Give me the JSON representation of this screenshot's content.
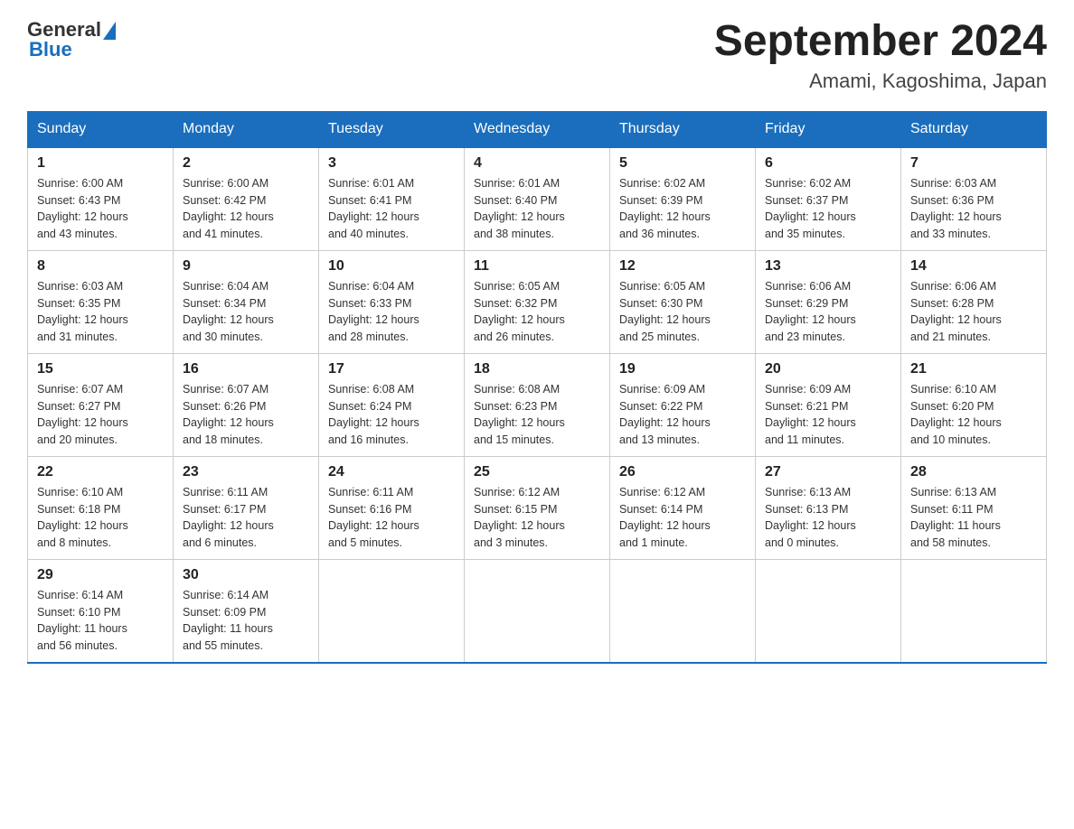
{
  "logo": {
    "general": "General",
    "blue": "Blue"
  },
  "title": "September 2024",
  "location": "Amami, Kagoshima, Japan",
  "days_of_week": [
    "Sunday",
    "Monday",
    "Tuesday",
    "Wednesday",
    "Thursday",
    "Friday",
    "Saturday"
  ],
  "weeks": [
    [
      {
        "day": "1",
        "info": "Sunrise: 6:00 AM\nSunset: 6:43 PM\nDaylight: 12 hours\nand 43 minutes."
      },
      {
        "day": "2",
        "info": "Sunrise: 6:00 AM\nSunset: 6:42 PM\nDaylight: 12 hours\nand 41 minutes."
      },
      {
        "day": "3",
        "info": "Sunrise: 6:01 AM\nSunset: 6:41 PM\nDaylight: 12 hours\nand 40 minutes."
      },
      {
        "day": "4",
        "info": "Sunrise: 6:01 AM\nSunset: 6:40 PM\nDaylight: 12 hours\nand 38 minutes."
      },
      {
        "day": "5",
        "info": "Sunrise: 6:02 AM\nSunset: 6:39 PM\nDaylight: 12 hours\nand 36 minutes."
      },
      {
        "day": "6",
        "info": "Sunrise: 6:02 AM\nSunset: 6:37 PM\nDaylight: 12 hours\nand 35 minutes."
      },
      {
        "day": "7",
        "info": "Sunrise: 6:03 AM\nSunset: 6:36 PM\nDaylight: 12 hours\nand 33 minutes."
      }
    ],
    [
      {
        "day": "8",
        "info": "Sunrise: 6:03 AM\nSunset: 6:35 PM\nDaylight: 12 hours\nand 31 minutes."
      },
      {
        "day": "9",
        "info": "Sunrise: 6:04 AM\nSunset: 6:34 PM\nDaylight: 12 hours\nand 30 minutes."
      },
      {
        "day": "10",
        "info": "Sunrise: 6:04 AM\nSunset: 6:33 PM\nDaylight: 12 hours\nand 28 minutes."
      },
      {
        "day": "11",
        "info": "Sunrise: 6:05 AM\nSunset: 6:32 PM\nDaylight: 12 hours\nand 26 minutes."
      },
      {
        "day": "12",
        "info": "Sunrise: 6:05 AM\nSunset: 6:30 PM\nDaylight: 12 hours\nand 25 minutes."
      },
      {
        "day": "13",
        "info": "Sunrise: 6:06 AM\nSunset: 6:29 PM\nDaylight: 12 hours\nand 23 minutes."
      },
      {
        "day": "14",
        "info": "Sunrise: 6:06 AM\nSunset: 6:28 PM\nDaylight: 12 hours\nand 21 minutes."
      }
    ],
    [
      {
        "day": "15",
        "info": "Sunrise: 6:07 AM\nSunset: 6:27 PM\nDaylight: 12 hours\nand 20 minutes."
      },
      {
        "day": "16",
        "info": "Sunrise: 6:07 AM\nSunset: 6:26 PM\nDaylight: 12 hours\nand 18 minutes."
      },
      {
        "day": "17",
        "info": "Sunrise: 6:08 AM\nSunset: 6:24 PM\nDaylight: 12 hours\nand 16 minutes."
      },
      {
        "day": "18",
        "info": "Sunrise: 6:08 AM\nSunset: 6:23 PM\nDaylight: 12 hours\nand 15 minutes."
      },
      {
        "day": "19",
        "info": "Sunrise: 6:09 AM\nSunset: 6:22 PM\nDaylight: 12 hours\nand 13 minutes."
      },
      {
        "day": "20",
        "info": "Sunrise: 6:09 AM\nSunset: 6:21 PM\nDaylight: 12 hours\nand 11 minutes."
      },
      {
        "day": "21",
        "info": "Sunrise: 6:10 AM\nSunset: 6:20 PM\nDaylight: 12 hours\nand 10 minutes."
      }
    ],
    [
      {
        "day": "22",
        "info": "Sunrise: 6:10 AM\nSunset: 6:18 PM\nDaylight: 12 hours\nand 8 minutes."
      },
      {
        "day": "23",
        "info": "Sunrise: 6:11 AM\nSunset: 6:17 PM\nDaylight: 12 hours\nand 6 minutes."
      },
      {
        "day": "24",
        "info": "Sunrise: 6:11 AM\nSunset: 6:16 PM\nDaylight: 12 hours\nand 5 minutes."
      },
      {
        "day": "25",
        "info": "Sunrise: 6:12 AM\nSunset: 6:15 PM\nDaylight: 12 hours\nand 3 minutes."
      },
      {
        "day": "26",
        "info": "Sunrise: 6:12 AM\nSunset: 6:14 PM\nDaylight: 12 hours\nand 1 minute."
      },
      {
        "day": "27",
        "info": "Sunrise: 6:13 AM\nSunset: 6:13 PM\nDaylight: 12 hours\nand 0 minutes."
      },
      {
        "day": "28",
        "info": "Sunrise: 6:13 AM\nSunset: 6:11 PM\nDaylight: 11 hours\nand 58 minutes."
      }
    ],
    [
      {
        "day": "29",
        "info": "Sunrise: 6:14 AM\nSunset: 6:10 PM\nDaylight: 11 hours\nand 56 minutes."
      },
      {
        "day": "30",
        "info": "Sunrise: 6:14 AM\nSunset: 6:09 PM\nDaylight: 11 hours\nand 55 minutes."
      },
      {
        "day": "",
        "info": ""
      },
      {
        "day": "",
        "info": ""
      },
      {
        "day": "",
        "info": ""
      },
      {
        "day": "",
        "info": ""
      },
      {
        "day": "",
        "info": ""
      }
    ]
  ]
}
